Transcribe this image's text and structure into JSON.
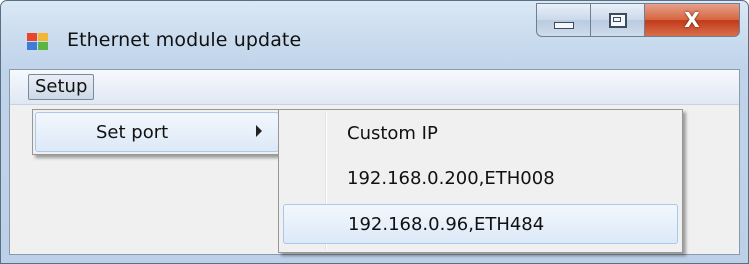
{
  "window": {
    "title": "Ethernet module update"
  },
  "caption_buttons": {
    "close_glyph": "X"
  },
  "menubar": {
    "setup_label": "Setup"
  },
  "submenu_setup": {
    "items": [
      {
        "label": "Set port",
        "has_submenu": true
      }
    ]
  },
  "submenu_set_port": {
    "items": [
      {
        "label": "Custom IP",
        "highlighted": false
      },
      {
        "label": "192.168.0.200,ETH008",
        "highlighted": false
      },
      {
        "label": "192.168.0.96,ETH484",
        "highlighted": true
      }
    ]
  },
  "colors": {
    "highlight_border": "#a8c8ec",
    "close_button": "#c2391a"
  }
}
